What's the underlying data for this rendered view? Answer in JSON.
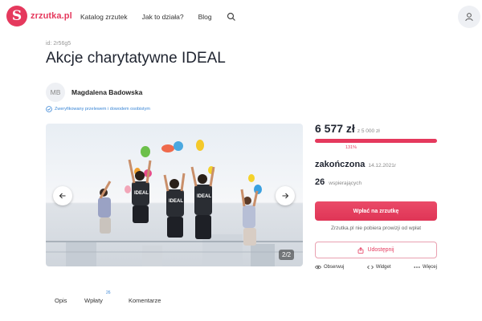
{
  "header": {
    "logo_mark": "S",
    "logo_text": "zrzutka.pl",
    "nav": [
      "Katalog zrzutek",
      "Jak to działa?",
      "Blog"
    ]
  },
  "campaign": {
    "id_label": "id: 2r56g5",
    "title": "Akcje charytatywne IDEAL",
    "author_initials": "MB",
    "author_name": "Magdalena Badowska",
    "verified_text": "Zweryfikowany przelewem i dowodem osobistym"
  },
  "carousel": {
    "counter": "2/2",
    "shirt_text": "IDEAL"
  },
  "tabs": {
    "description": "Opis",
    "payments": "Wpłaty",
    "payments_count": "26",
    "comments": "Komentarze"
  },
  "summary": {
    "raised": "6 577 zł",
    "goal": "z 5 000 zł",
    "percent_label": "131%",
    "progress_fraction": 1.0,
    "status": "zakończona",
    "end_date": "14.12.2021r",
    "supporters_count": "26",
    "supporters_label": "wspierających",
    "donate_label": "Wpłać na zrzutkę",
    "no_fee_note": "Zrzutka.pl nie pobiera prowizji od wpłat",
    "share_label": "Udostępnij",
    "actions": {
      "observe": "Obserwuj",
      "widget": "Widget",
      "more": "Więcej"
    }
  },
  "colors": {
    "brand": "#e5395d",
    "link": "#3a86d6"
  }
}
